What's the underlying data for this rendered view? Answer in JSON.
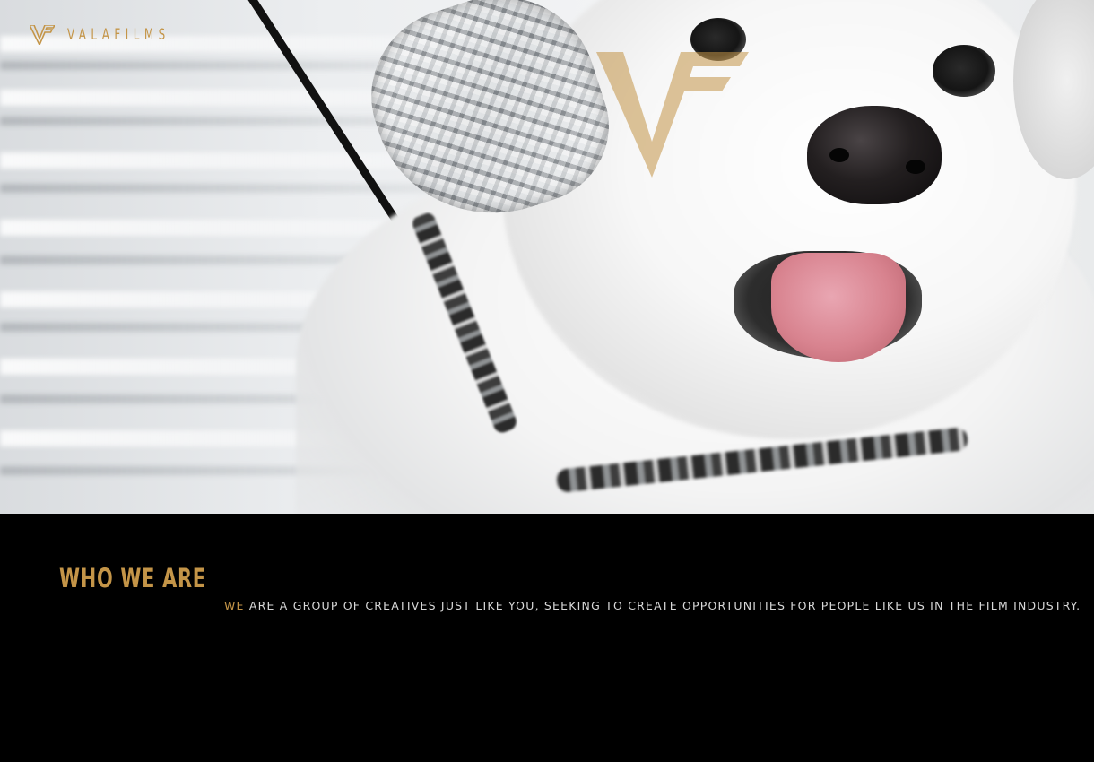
{
  "brand": {
    "name": "VALAFILMS",
    "icon": "vf-monogram-icon",
    "accent_color": "#c49548"
  },
  "hero": {
    "image": "white-terrier-with-foil-hat",
    "watermark_icon": "vf-monogram-icon"
  },
  "about": {
    "title": "WHO WE ARE",
    "lead_word": "WE",
    "body": "ARE A GROUP OF CREATIVES JUST LIKE YOU, SEEKING TO CREATE OPPORTUNITIES FOR PEOPLE LIKE US IN THE FILM INDUSTRY."
  }
}
